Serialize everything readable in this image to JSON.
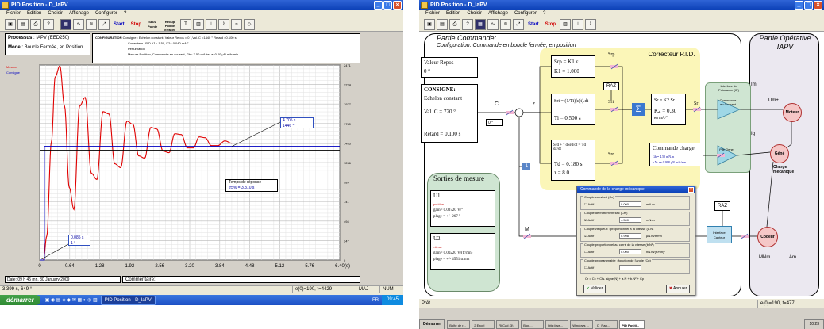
{
  "left": {
    "title": "PID Position - D_IaPV",
    "menu": [
      "Fichier",
      "Edition",
      "Choisir",
      "Affichage",
      "Configurer",
      "?"
    ],
    "toolbar": {
      "start": "Start",
      "stop": "Stop",
      "btn_a": "Sauv Pointe",
      "btn_b": "Recup Pointe Effacer",
      "t": "T"
    },
    "header": {
      "processus_label": "Processus",
      "processus_value": ": IAPV (EED250)",
      "mode_label": "Mode",
      "mode_value": ": Boucle Fermée, en Position",
      "config_title": "CONFIGURATION",
      "config_lines": [
        "Consigne : Echelon constant, Valeur Repos = 0 °,Val. C =1440 ° Retard =0.100 s",
        "Correcteur : PID K1= 1.50, K2= 0.040 mA/°",
        "Perturbation",
        "Mesure Position, Commande en courant, Gb= 7.50 mA/bs, a=0.00 µN.m/tr/min"
      ]
    },
    "legend": [
      "Mesure",
      "Consigne"
    ],
    "chart_data": {
      "type": "line",
      "x_unit": "(s)",
      "xlim": [
        0,
        6.4
      ],
      "ylim": [
        0,
        2471
      ],
      "x_ticks": [
        "0",
        "0.64",
        "1.28",
        "1.92",
        "2.56",
        "3.20",
        "3.84",
        "4.48",
        "5.12",
        "5.76",
        "6.40"
      ],
      "y_ticks": [
        "2471",
        "2224",
        "1977",
        "1730",
        "1483",
        "1236",
        "989",
        "741",
        "494",
        "247",
        "0"
      ],
      "series": [
        {
          "name": "Mesure",
          "color": "#e00000",
          "x": [
            0,
            0.08,
            0.15,
            0.25,
            0.33,
            0.43,
            0.53,
            0.63,
            0.73,
            0.85,
            0.97,
            1.1,
            1.22,
            1.35,
            1.48,
            1.6,
            1.73,
            1.86,
            1.99,
            2.11,
            2.24,
            2.37,
            2.5,
            2.63,
            2.76,
            2.88,
            3.02,
            3.15,
            3.28,
            3.4,
            3.53,
            3.66,
            3.8,
            3.95,
            4.1
          ],
          "y": [
            0,
            0,
            300,
            1500,
            2320,
            2460,
            1950,
            920,
            640,
            1950,
            2060,
            1100,
            1020,
            1880,
            1850,
            1220,
            1170,
            1760,
            1720,
            1320,
            1290,
            1680,
            1660,
            1380,
            1360,
            1600,
            1590,
            1420,
            1420,
            1560,
            1550,
            1450,
            1450,
            1510,
            1480
          ]
        },
        {
          "name": "Consigne",
          "color": "#0000c0",
          "x": [
            0,
            0.1,
            0.1,
            6.4
          ],
          "y": [
            0,
            0,
            1440,
            1440
          ]
        }
      ]
    },
    "labels": {
      "final_time": "4.705 s",
      "final_value": "1446 °",
      "response_title": "Temps de réponse",
      "response_value": "tr5% = 3.310 s",
      "start_time": "0.085 s",
      "start_value": "1 °"
    },
    "footer": {
      "date": "Date: 09 h 45 mn, 30 January 2009",
      "comment": "Commentaire:"
    },
    "status": {
      "coords": "3.399 s, 649 °",
      "right": "e(0)=190, t=4429",
      "maj": "MAJ",
      "num": "NUM"
    },
    "taskbar": {
      "start": "démarrer",
      "task": "PID Position - D_IaPV",
      "lang": "FR",
      "clock": "09:45"
    }
  },
  "right": {
    "title": "PID Position - D_IaPV",
    "menu": [
      "Fichier",
      "Edition",
      "Choisir",
      "Affichage",
      "Configurer",
      "?"
    ],
    "toolbar": {
      "start": "Start",
      "stop": "Stop"
    },
    "commande": {
      "title": "Partie Commande:",
      "config": "Configuration:  Commande en boucle fermée, en position",
      "valeur_repos_label": "Valeur Repos",
      "valeur_repos_value": "0 °",
      "consigne_title": "CONSIGNE:",
      "consigne_type": "Echelon constant",
      "val_c": "Val. C = 720 °",
      "retard": "Retard = 0.100 s",
      "c_label": "C",
      "c_value": "0 °",
      "e_label": "ε",
      "m_label": "M",
      "minus_one": "-1"
    },
    "correcteur": {
      "title": "Correcteur P.I.D.",
      "srp": "Srp",
      "srp_eq": "Srp = K1.ε",
      "k1": "K1 = 1.000",
      "raz": "RAZ",
      "sri": "Sri",
      "sri_eq": "Sri = (1/Ti)∫ε(t).dt",
      "ti": "Ti = 0.500 s",
      "srd": "Srd",
      "srd_eq": "Srd + τ dSrd/dt = Td dε/dt",
      "td": "Td = 0.180 s",
      "tau": "τ = 8.0",
      "sum": "Σ",
      "sr_eq": "Sr = K2.Sr",
      "k2": "K2 = 0.30",
      "k2_unit": "en mA/°",
      "sr_out": "Sr"
    },
    "commande_charge": {
      "title": "Commande charge",
      "line1": "Gb = 4.50 mN.m",
      "line2": "a.N: a= 0.998 µN.m/tr/mn"
    },
    "operative": {
      "title": "Partie Opérative IAPV",
      "im": "Im",
      "umot": "Um+",
      "ig": "Ig",
      "moteur": "Moteur",
      "gene": "Géné",
      "charge": "Charge mécanique",
      "codeur": "Codeur",
      "mn": "MNm",
      "am": "Am",
      "raz": "RAZ",
      "interface_capteur": "Interface Capteur",
      "interface_puissance": "Interface de Puissance (IP)",
      "commande_courant": "Commande en Courant",
      "pile_gene": "Pile Gene"
    },
    "sorties": {
      "title": "Sorties de mesure",
      "u1": "U1",
      "u1_kind": "position",
      "u1_gain": "gain= 0.03720 V/°",
      "u1_plage": "plage = +/- 267 °",
      "u2": "U2",
      "u2_kind": "vitesse",
      "u2_gain": "gain= 0.00220 V/(tr/mn)",
      "u2_plage": "plage = +/- 4551 tr/mn"
    },
    "dialog": {
      "title": "Commande de la charge mécanique",
      "groups": [
        {
          "title": "Couple constant (Cc)",
          "check": "Actif",
          "value": "0.000",
          "unit": "mN.m"
        },
        {
          "title": "Couple de frottement sec (Cfs)",
          "check": "Actif",
          "value": "4.500",
          "unit": "mN.m"
        },
        {
          "title": "Couple visqueux : proportionnel à la vitesse (a.N)",
          "check": "Actif",
          "value": "0.998",
          "unit": "µN.m/tr/mn"
        },
        {
          "title": "Couple proportionnel au carré de la vitesse (b.N²)",
          "check": "Actif",
          "value": "0.000",
          "unit": "nN.m/(tr/mn)²"
        },
        {
          "title": "Couple programmable : fonction de l'angle (Cp)",
          "check": "Actif",
          "value": "",
          "unit": ""
        }
      ],
      "formula": "Cr = Cc + Cfs. signe(N) + a.N + b.N² + Cp",
      "ok": "Valider",
      "cancel": "Annuler"
    },
    "status": {
      "left": "Prêt",
      "right": "e(0)=190, t=477"
    },
    "taskbar": {
      "start": "Démarrer",
      "tasks": [
        "Boîte de r...",
        "2 Excel",
        "Ri Cad (3)",
        "Blog...",
        "http://ww...",
        "Windows ...",
        "D_Rag...",
        "PID Positi..."
      ],
      "clock": "10:23"
    }
  }
}
